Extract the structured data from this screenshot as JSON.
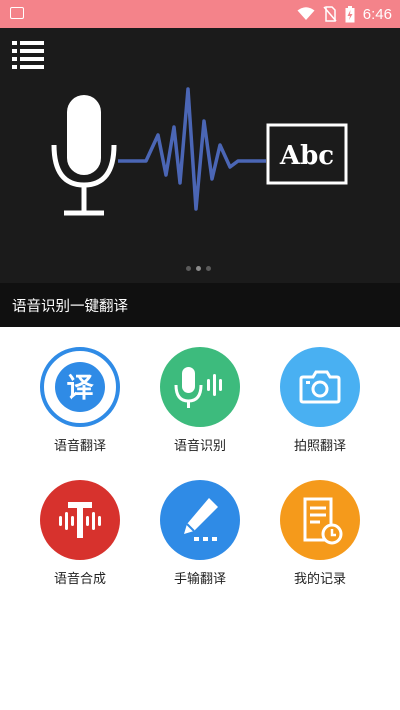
{
  "status_bar": {
    "time": "6:46",
    "icons": [
      "image-icon",
      "wifi-icon",
      "no-sim-icon",
      "battery-charging-icon"
    ],
    "color": "#f4838a"
  },
  "banner": {
    "menu_icon": "list-menu-icon",
    "art_text": "Abc",
    "caption": "语音识别一键翻译",
    "page_count": 3,
    "active_page": 1
  },
  "features": [
    {
      "label": "语音翻译",
      "icon": "translate-icon",
      "color": "#2f8be6",
      "glyph": "译"
    },
    {
      "label": "语音识别",
      "icon": "microphone-waveform-icon",
      "color": "#3dbb7d"
    },
    {
      "label": "拍照翻译",
      "icon": "camera-icon",
      "color": "#49b0f2"
    },
    {
      "label": "语音合成",
      "icon": "text-to-speech-icon",
      "color": "#d7322d"
    },
    {
      "label": "手输翻译",
      "icon": "pen-input-icon",
      "color": "#2f8be6"
    },
    {
      "label": "我的记录",
      "icon": "history-record-icon",
      "color": "#f59a1b"
    }
  ]
}
